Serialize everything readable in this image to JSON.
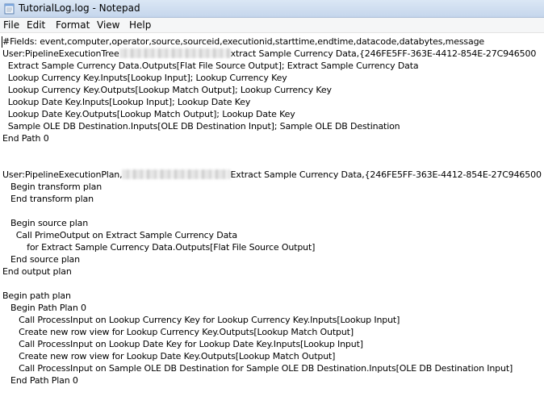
{
  "window": {
    "title": "TutorialLog.log - Notepad"
  },
  "menu": {
    "items": [
      "File",
      "Edit",
      "Format",
      "View",
      "Help"
    ]
  },
  "editor": {
    "lines": [
      "#Fields: event,computer,operator,source,sourceid,executionid,starttime,endtime,datacode,databytes,message",
      "User:PipelineExecutionTree",
      "xtract Sample Currency Data,{246FE5FF-363E-4412-854E-27C946500",
      "  Extract Sample Currency Data.Outputs[Flat File Source Output]; Extract Sample Currency Data",
      "  Lookup Currency Key.Inputs[Lookup Input]; Lookup Currency Key",
      "  Lookup Currency Key.Outputs[Lookup Match Output]; Lookup Currency Key",
      "  Lookup Date Key.Inputs[Lookup Input]; Lookup Date Key",
      "  Lookup Date Key.Outputs[Lookup Match Output]; Lookup Date Key",
      "  Sample OLE DB Destination.Inputs[OLE DB Destination Input]; Sample OLE DB Destination",
      "End Path 0",
      "User:PipelineExecutionPlan,",
      "Extract Sample Currency Data,{246FE5FF-363E-4412-854E-27C946500",
      "   Begin transform plan",
      "   End transform plan",
      "   Begin source plan",
      "     Call PrimeOutput on Extract Sample Currency Data",
      "         for Extract Sample Currency Data.Outputs[Flat File Source Output]",
      "   End source plan",
      "End output plan",
      "Begin path plan",
      "   Begin Path Plan 0",
      "      Call ProcessInput on Lookup Currency Key for Lookup Currency Key.Inputs[Lookup Input]",
      "      Create new row view for Lookup Currency Key.Outputs[Lookup Match Output]",
      "      Call ProcessInput on Lookup Date Key for Lookup Date Key.Inputs[Lookup Input]",
      "      Create new row view for Lookup Date Key.Outputs[Lookup Match Output]",
      "      Call ProcessInput on Sample OLE DB Destination for Sample OLE DB Destination.Inputs[OLE DB Destination Input]",
      "   End Path Plan 0"
    ]
  }
}
